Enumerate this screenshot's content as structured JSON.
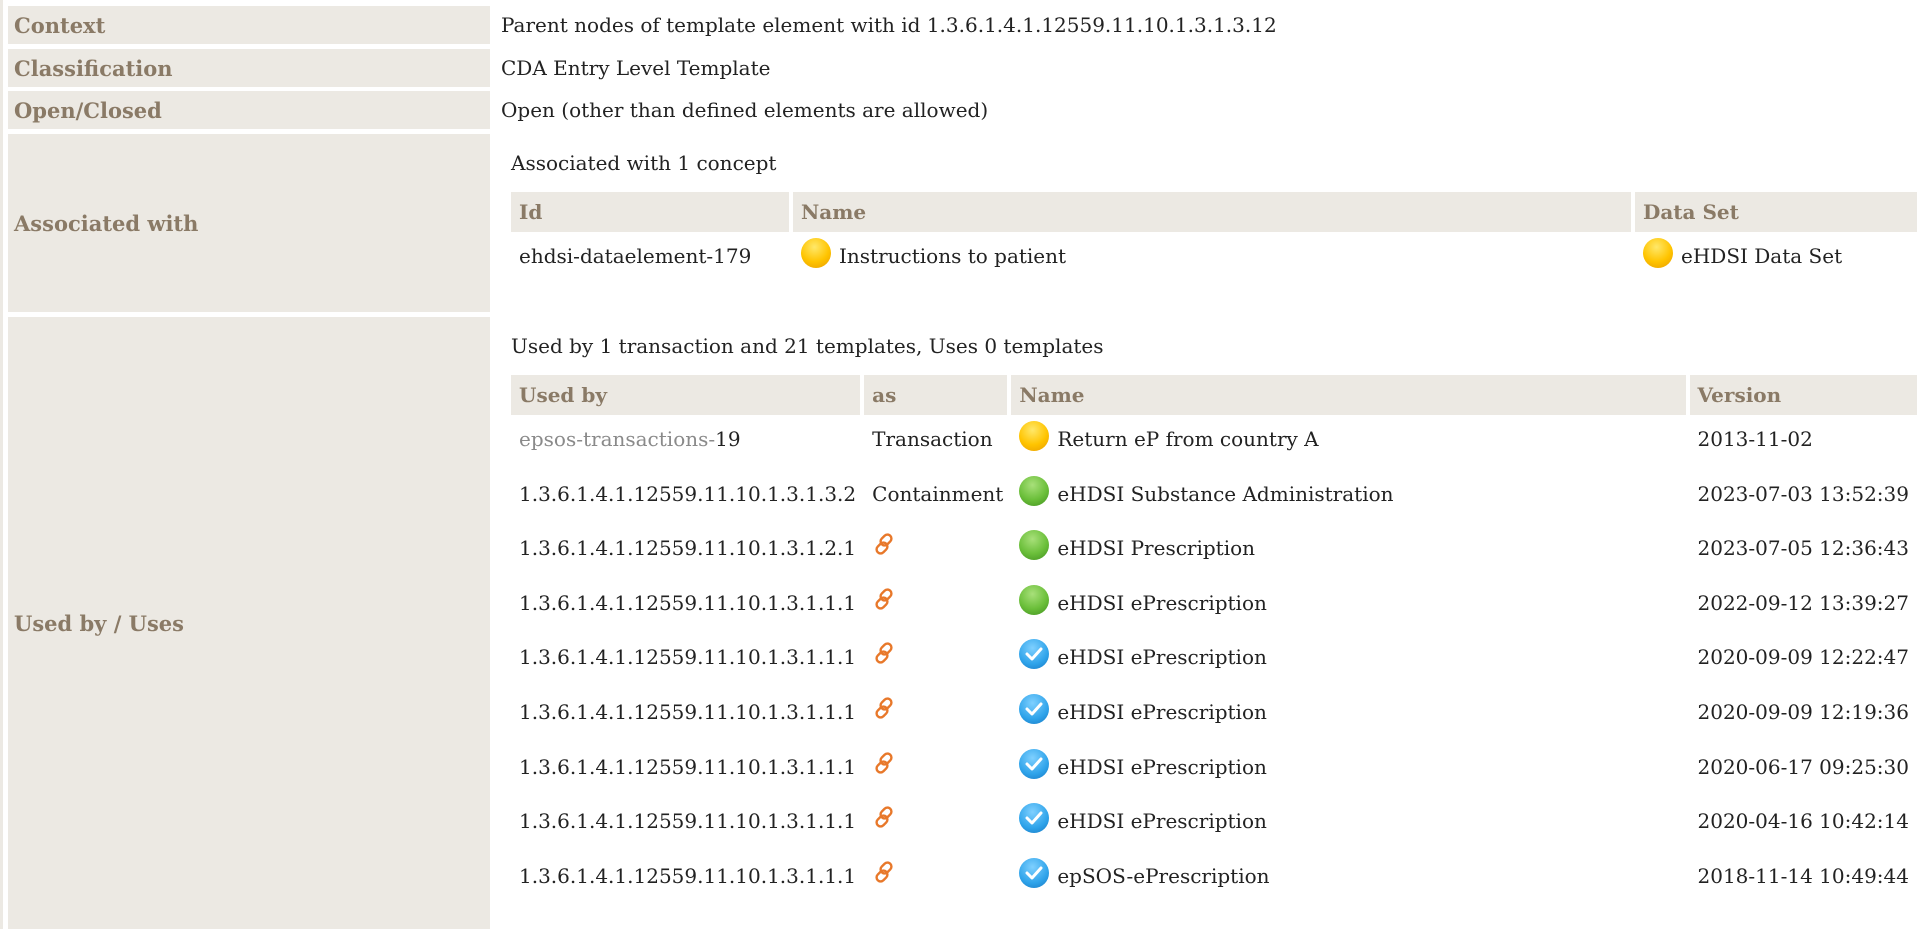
{
  "rows": {
    "context": {
      "label": "Context",
      "value": "Parent nodes of template element with id 1.3.6.1.4.1.12559.11.10.1.3.1.3.12"
    },
    "classification": {
      "label": "Classification",
      "value": "CDA Entry Level Template"
    },
    "open_closed": {
      "label": "Open/Closed",
      "value": "Open (other than defined elements are allowed)"
    },
    "associated": {
      "label": "Associated with",
      "subtitle": "Associated with 1 concept",
      "headers": {
        "id": "Id",
        "name": "Name",
        "dataset": "Data Set"
      },
      "items": [
        {
          "id": "ehdsi-dataelement-179",
          "name": "Instructions to patient",
          "name_icon": "yellow-status-icon",
          "dataset": "eHDSI Data Set",
          "dataset_icon": "yellow-status-icon"
        }
      ]
    },
    "used_by": {
      "label": "Used by / Uses",
      "subtitle": "Used by 1 transaction and 21 templates, Uses 0 templates",
      "headers": {
        "used_by": "Used by",
        "as": "as",
        "name": "Name",
        "version": "Version"
      },
      "items": [
        {
          "used_by_prefix": "epsos-transactions-",
          "used_by_suffix": "19",
          "as": "Transaction",
          "as_icon": "",
          "status": "yellow",
          "name": "Return eP from country A",
          "version": "2013-11-02"
        },
        {
          "used_by_prefix": "",
          "used_by_suffix": "1.3.6.1.4.1.12559.11.10.1.3.1.3.2",
          "as": "Containment",
          "as_icon": "",
          "status": "green",
          "name": "eHDSI Substance Administration",
          "version": "2023-07-03 13:52:39"
        },
        {
          "used_by_prefix": "",
          "used_by_suffix": "1.3.6.1.4.1.12559.11.10.1.3.1.2.1",
          "as": "",
          "as_icon": "link-icon",
          "status": "green",
          "name": "eHDSI Prescription",
          "version": "2023-07-05 12:36:43"
        },
        {
          "used_by_prefix": "",
          "used_by_suffix": "1.3.6.1.4.1.12559.11.10.1.3.1.1.1",
          "as": "",
          "as_icon": "link-icon",
          "status": "green",
          "name": "eHDSI ePrescription",
          "version": "2022-09-12 13:39:27"
        },
        {
          "used_by_prefix": "",
          "used_by_suffix": "1.3.6.1.4.1.12559.11.10.1.3.1.1.1",
          "as": "",
          "as_icon": "link-icon",
          "status": "blue",
          "name": "eHDSI ePrescription",
          "version": "2020-09-09 12:22:47"
        },
        {
          "used_by_prefix": "",
          "used_by_suffix": "1.3.6.1.4.1.12559.11.10.1.3.1.1.1",
          "as": "",
          "as_icon": "link-icon",
          "status": "blue",
          "name": "eHDSI ePrescription",
          "version": "2020-09-09 12:19:36"
        },
        {
          "used_by_prefix": "",
          "used_by_suffix": "1.3.6.1.4.1.12559.11.10.1.3.1.1.1",
          "as": "",
          "as_icon": "link-icon",
          "status": "blue",
          "name": "eHDSI ePrescription",
          "version": "2020-06-17 09:25:30"
        },
        {
          "used_by_prefix": "",
          "used_by_suffix": "1.3.6.1.4.1.12559.11.10.1.3.1.1.1",
          "as": "",
          "as_icon": "link-icon",
          "status": "blue",
          "name": "eHDSI ePrescription",
          "version": "2020-04-16 10:42:14"
        },
        {
          "used_by_prefix": "",
          "used_by_suffix": "1.3.6.1.4.1.12559.11.10.1.3.1.1.1",
          "as": "",
          "as_icon": "link-icon",
          "status": "blue",
          "name": "epSOS-ePrescription",
          "version": "2018-11-14 10:49:44"
        }
      ]
    }
  },
  "colors": {
    "label_bg": "#ece9e3",
    "label_text": "#8a7a66",
    "link_icon": "#e8782a",
    "status_yellow": "#ffc400",
    "status_green": "#6bbf3a",
    "status_blue": "#2ea3ea"
  }
}
